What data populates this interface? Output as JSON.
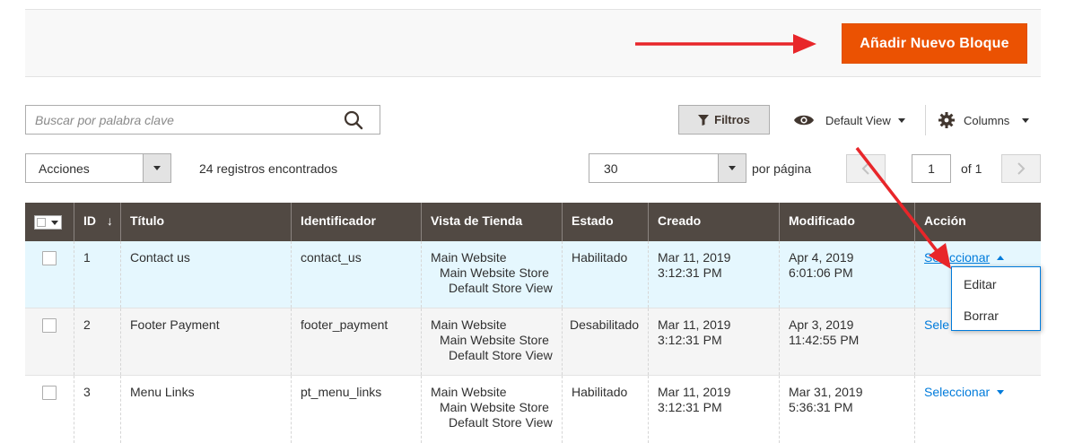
{
  "header": {
    "add_button_label": "Añadir Nuevo Bloque"
  },
  "search": {
    "placeholder": "Buscar por palabra clave",
    "value": ""
  },
  "toolbar": {
    "filters_label": "Filtros",
    "view_label": "Default View",
    "columns_label": "Columns",
    "actions_label": "Acciones",
    "records_found": "24 registros encontrados",
    "per_page_value": "30",
    "per_page_label": "por página",
    "current_page": "1",
    "page_total": "of 1"
  },
  "grid": {
    "columns": [
      "ID",
      "Título",
      "Identificador",
      "Vista de Tienda",
      "Estado",
      "Creado",
      "Modificado",
      "Acción"
    ],
    "sort_indicator": "↓",
    "rows": [
      {
        "id": "1",
        "title": "Contact us",
        "identifier": "contact_us",
        "store_view": [
          "Main Website",
          "Main Website Store",
          "Default Store View"
        ],
        "status": "Habilitado",
        "created": "Mar 11, 2019 3:12:31 PM",
        "modified": "Apr 4, 2019 6:01:06 PM",
        "action": "Seleccionar"
      },
      {
        "id": "2",
        "title": "Footer Payment",
        "identifier": "footer_payment",
        "store_view": [
          "Main Website",
          "Main Website Store",
          "Default Store View"
        ],
        "status": "Desabilitado",
        "created": "Mar 11, 2019 3:12:31 PM",
        "modified": "Apr 3, 2019 11:42:55 PM",
        "action": "Sele"
      },
      {
        "id": "3",
        "title": "Menu Links",
        "identifier": "pt_menu_links",
        "store_view": [
          "Main Website",
          "Main Website Store",
          "Default Store View"
        ],
        "status": "Habilitado",
        "created": "Mar 11, 2019 3:12:31 PM",
        "modified": "Mar 31, 2019 5:36:31 PM",
        "action": "Seleccionar"
      }
    ]
  },
  "action_menu": {
    "edit_label": "Editar",
    "delete_label": "Borrar"
  },
  "colors": {
    "primary_button": "#eb5202",
    "grid_header": "#514943",
    "link": "#007bdb",
    "highlight_row": "#e5f7fe",
    "annotation_arrow": "#e8262a"
  }
}
